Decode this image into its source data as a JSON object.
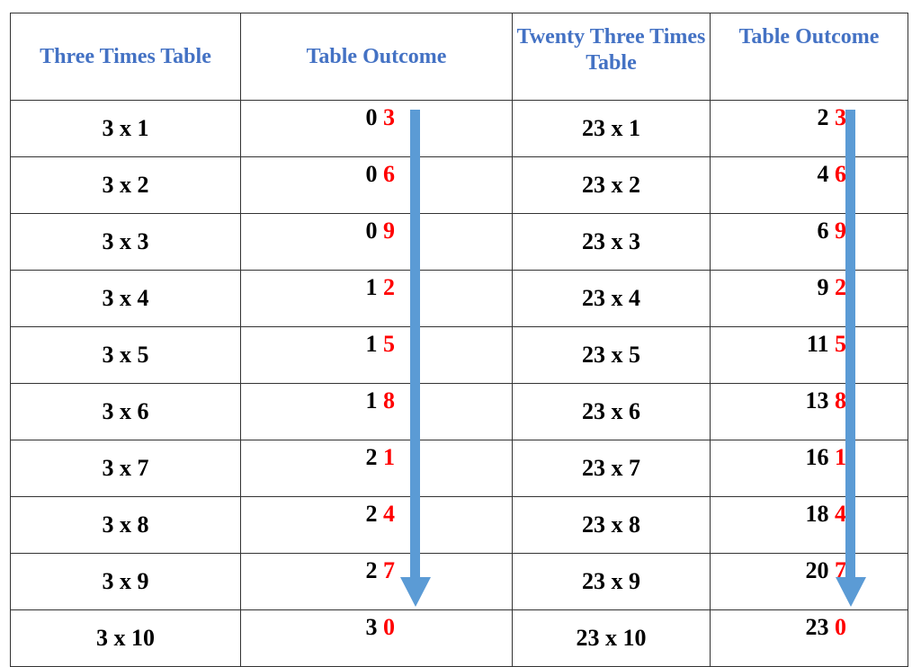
{
  "headers": [
    "Three Times Table",
    "Table Outcome",
    "Twenty Three Times Table",
    "Table Outcome"
  ],
  "header_color": "#4472c4",
  "digit_highlight_color": "#ff0000",
  "arrow_color": "#5b9bd5",
  "rows": [
    {
      "three": "3 x 1",
      "three_tens": "0",
      "three_ones": "3",
      "twentythree": "23 x 1",
      "tt_tens": "2",
      "tt_ones": "3"
    },
    {
      "three": "3 x 2",
      "three_tens": "0",
      "three_ones": "6",
      "twentythree": "23 x 2",
      "tt_tens": "4",
      "tt_ones": "6"
    },
    {
      "three": "3 x 3",
      "three_tens": "0",
      "three_ones": "9",
      "twentythree": "23 x 3",
      "tt_tens": "6",
      "tt_ones": "9"
    },
    {
      "three": "3 x 4",
      "three_tens": "1",
      "three_ones": "2",
      "twentythree": "23 x 4",
      "tt_tens": "9",
      "tt_ones": "2"
    },
    {
      "three": "3 x 5",
      "three_tens": "1",
      "three_ones": "5",
      "twentythree": "23 x 5",
      "tt_tens": "11",
      "tt_ones": "5"
    },
    {
      "three": "3 x 6",
      "three_tens": "1",
      "three_ones": "8",
      "twentythree": "23 x 6",
      "tt_tens": "13",
      "tt_ones": "8"
    },
    {
      "three": "3 x 7",
      "three_tens": "2",
      "three_ones": "1",
      "twentythree": "23 x 7",
      "tt_tens": "16",
      "tt_ones": "1"
    },
    {
      "three": "3 x 8",
      "three_tens": "2",
      "three_ones": "4",
      "twentythree": "23 x 8",
      "tt_tens": "18",
      "tt_ones": "4"
    },
    {
      "three": "3 x 9",
      "three_tens": "2",
      "three_ones": "7",
      "twentythree": "23 x 9",
      "tt_tens": "20",
      "tt_ones": "7"
    },
    {
      "three": "3 x 10",
      "three_tens": "3",
      "three_ones": "0",
      "twentythree": "23 x 10",
      "tt_tens": "23",
      "tt_ones": "0"
    }
  ]
}
